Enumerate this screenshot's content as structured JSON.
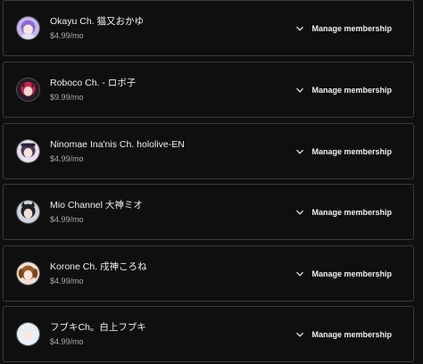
{
  "memberships": [
    {
      "name": "Okayu Ch. 猫又おかゆ",
      "price": "$4.99/mo",
      "action_label": "Manage membership",
      "avatar_colors": {
        "bg": "#c9b6f0",
        "hair": "#8a6ad1",
        "face": "#f5e6dc"
      },
      "icon": "chevron-down-icon"
    },
    {
      "name": "Roboco Ch. - ロボ子",
      "price": "$9.99/mo",
      "action_label": "Manage membership",
      "avatar_colors": {
        "bg": "#2a1a2a",
        "hair": "#c02a4a",
        "face": "#f1d7cf"
      },
      "icon": "chevron-down-icon"
    },
    {
      "name": "Ninomae Ina'nis Ch. hololive-EN",
      "price": "$4.99/mo",
      "action_label": "Manage membership",
      "avatar_colors": {
        "bg": "#e9e0ef",
        "hair": "#4a3a5a",
        "face": "#f6e3da"
      },
      "icon": "chevron-down-icon"
    },
    {
      "name": "Mio Channel 大神ミオ",
      "price": "$4.99/mo",
      "action_label": "Manage membership",
      "avatar_colors": {
        "bg": "#cfd6e0",
        "hair": "#1f1f24",
        "face": "#f2dfd5"
      },
      "icon": "chevron-down-icon"
    },
    {
      "name": "Korone Ch. 戌神ころね",
      "price": "$4.99/mo",
      "action_label": "Manage membership",
      "avatar_colors": {
        "bg": "#f3e0d2",
        "hair": "#9a5a2a",
        "face": "#f7e5da"
      },
      "icon": "chevron-down-icon"
    },
    {
      "name": "フブキCh。白上フブキ",
      "price": "$4.99/mo",
      "action_label": "Manage membership",
      "avatar_colors": {
        "bg": "#e8f0f8",
        "hair": "#eaeef2",
        "face": "#f7e9e1"
      },
      "icon": "chevron-down-icon"
    }
  ]
}
